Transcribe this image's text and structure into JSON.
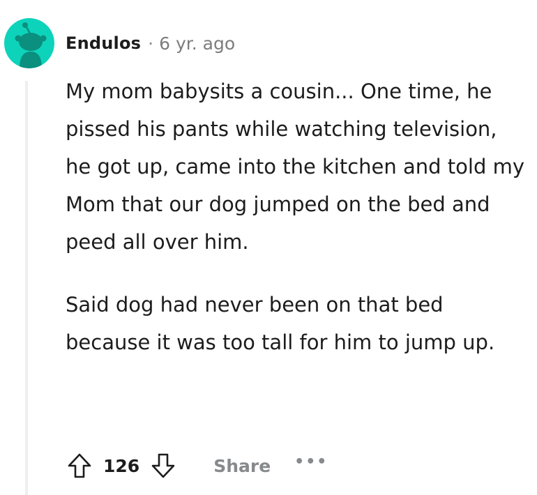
{
  "comment": {
    "author": "Endulos",
    "separator": "·",
    "time": "6 yr. ago",
    "paragraphs": [
      "My mom babysits a cousin... One time, he pissed his pants while watching television, he got up, came into the kitchen and told my Mom that our dog jumped on the bed and peed all over him.",
      "Said dog had never been on that bed because it was too tall for him to jump up."
    ],
    "score": "126",
    "share_label": "Share",
    "more_label": "•••"
  },
  "colors": {
    "avatar_bg": "#0dd3bb",
    "text": "#1c1c1c",
    "muted": "#878a8c",
    "thread_line": "#edeff1"
  },
  "icons": {
    "avatar": "reddit-snoo-avatar-icon",
    "upvote": "upvote-arrow-icon",
    "downvote": "downvote-arrow-icon",
    "more": "more-options-icon"
  }
}
